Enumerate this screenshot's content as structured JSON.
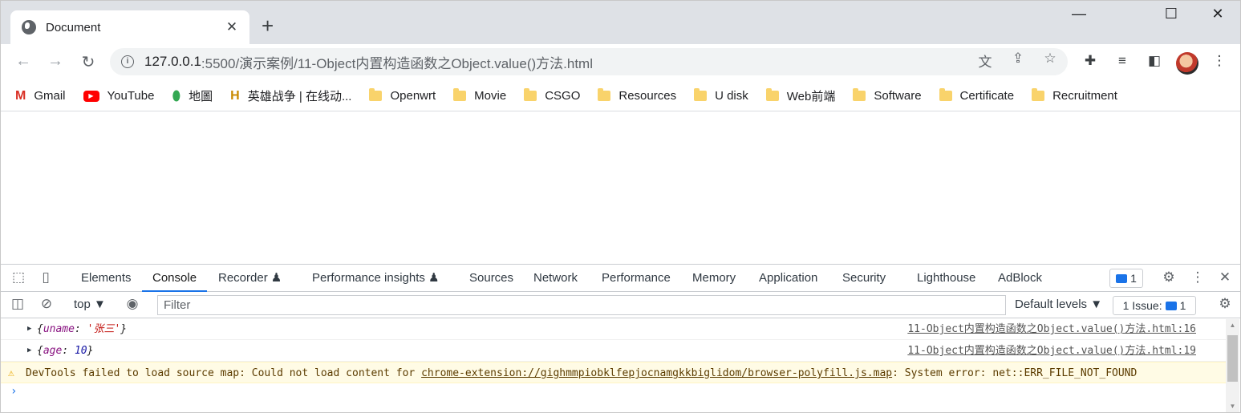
{
  "browser": {
    "tab_title": "Document",
    "tab_close": "✕",
    "new_tab": "+",
    "window_controls": {
      "minimize": "—",
      "maximize": "☐",
      "close": "✕"
    }
  },
  "toolbar": {
    "back": "←",
    "forward": "→",
    "reload": "↻",
    "url_host": "127.0.0.1",
    "url_path": ":5500/演示案例/11-Object内置构造函数之Object.value()方法.html",
    "menu": "⋮"
  },
  "bookmarks": [
    {
      "label": "Gmail",
      "icon": "gmail-icon",
      "glyph": "M"
    },
    {
      "label": "YouTube",
      "icon": "youtube-icon",
      "glyph": "▶"
    },
    {
      "label": "地圖",
      "icon": "maps-pin-icon",
      "glyph": "📍"
    },
    {
      "label": "英雄战争 | 在线动...",
      "icon": "game-icon",
      "glyph": "H"
    },
    {
      "label": "Openwrt",
      "icon": "folder-icon"
    },
    {
      "label": "Movie",
      "icon": "folder-icon"
    },
    {
      "label": "CSGO",
      "icon": "folder-icon"
    },
    {
      "label": "Resources",
      "icon": "folder-icon"
    },
    {
      "label": "U disk",
      "icon": "folder-icon"
    },
    {
      "label": "Web前端",
      "icon": "folder-icon"
    },
    {
      "label": "Software",
      "icon": "folder-icon"
    },
    {
      "label": "Certificate",
      "icon": "folder-icon"
    },
    {
      "label": "Recruitment",
      "icon": "folder-icon"
    }
  ],
  "devtools": {
    "tabs": [
      "Elements",
      "Console",
      "Recorder ♟",
      "Performance insights ♟",
      "Sources",
      "Network",
      "Performance",
      "Memory",
      "Application",
      "Security",
      "Lighthouse",
      "AdBlock"
    ],
    "active_tab": "Console",
    "issue_count": "1",
    "context": "top ▼",
    "filter_placeholder": "Filter",
    "levels": "Default levels ▼",
    "issues_label": "1 Issue:",
    "issues_count": "1",
    "accent_color": "#1a73e8"
  },
  "console": {
    "logs": [
      {
        "open": "{",
        "key": "uname",
        "sep": ": ",
        "value": "'张三'",
        "close": "}",
        "source": "11-Object内置构造函数之Object.value()方法.html:16"
      },
      {
        "open": "{",
        "key": "age",
        "sep": ": ",
        "value": "10",
        "close": "}",
        "source": "11-Object内置构造函数之Object.value()方法.html:19"
      }
    ],
    "warning": {
      "prefix": "DevTools failed to load source map: Could not load content for ",
      "link": "chrome-extension://gighmmpiobklfepjocnamgkkbiglidom/browser-polyfill.js.map",
      "suffix": ": System error: net::ERR_FILE_NOT_FOUND"
    },
    "prompt": "›"
  }
}
